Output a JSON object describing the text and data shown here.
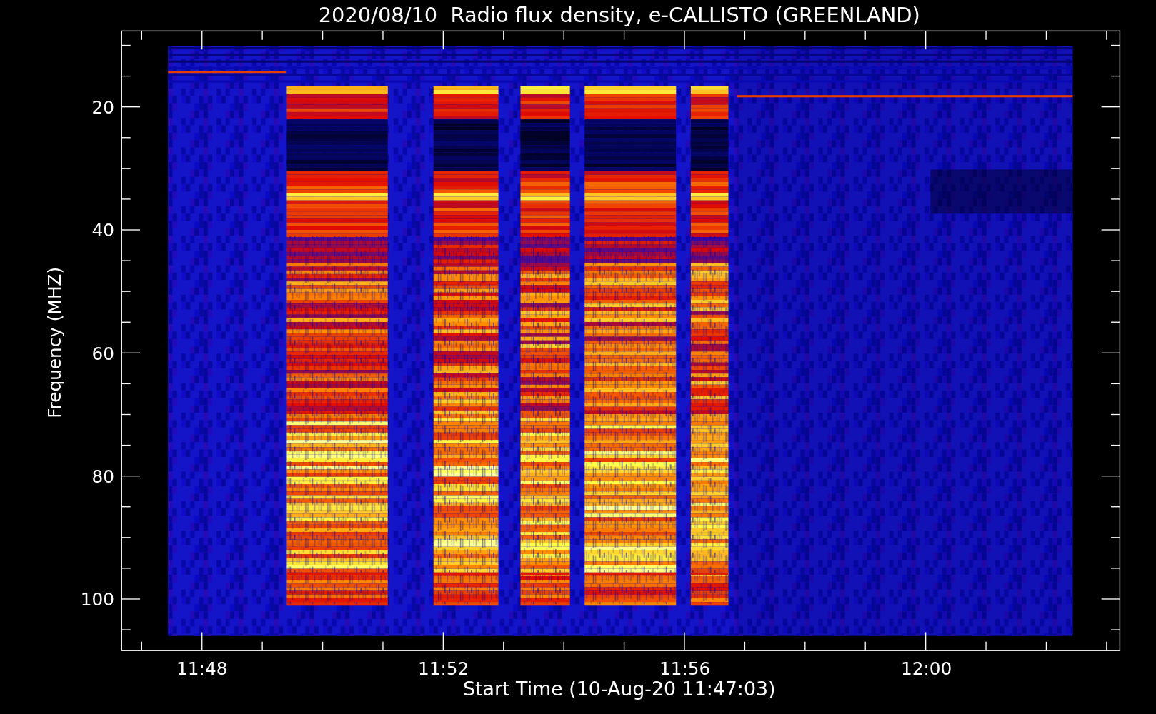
{
  "title": "2020/08/10  Radio flux density, e-CALLISTO (GREENLAND)",
  "y_axis": {
    "label": "Frequency (MHZ)",
    "ticks": [
      "20",
      "40",
      "60",
      "80",
      "100"
    ]
  },
  "x_axis": {
    "label": "Start Time (10-Aug-20 11:47:03)",
    "ticks": [
      "11:48",
      "11:52",
      "11:56",
      "12:00"
    ]
  }
}
